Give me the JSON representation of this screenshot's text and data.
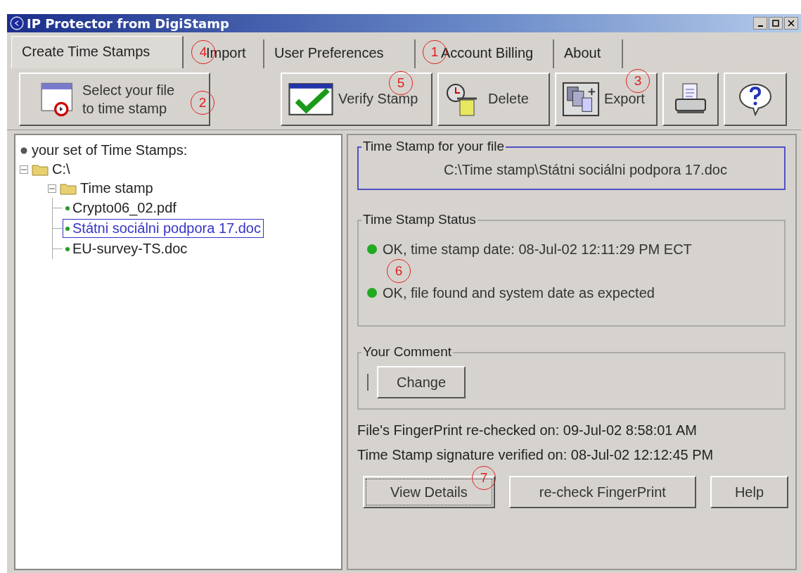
{
  "window": {
    "title": "IP Protector from DigiStamp"
  },
  "tabs": [
    {
      "label": "Create Time Stamps",
      "selected": true
    },
    {
      "label": "Import",
      "selected": false
    },
    {
      "label": "User Preferences",
      "selected": false
    },
    {
      "label": "Account Billing",
      "selected": false
    },
    {
      "label": "About",
      "selected": false
    }
  ],
  "toolbar": [
    {
      "kind": "select",
      "label_lines": [
        "Select your file",
        "to time stamp"
      ]
    },
    {
      "kind": "verify",
      "label": "Verify Stamp"
    },
    {
      "kind": "delete",
      "label": "Delete"
    },
    {
      "kind": "export",
      "label": "Export"
    },
    {
      "kind": "print"
    },
    {
      "kind": "help"
    }
  ],
  "tree": {
    "root": "your set of Time Stamps:",
    "children": [
      {
        "label": "C:\\",
        "kind": "folder",
        "expanded": true,
        "children": [
          {
            "label": "Time stamp",
            "kind": "folder",
            "expanded": true,
            "children": [
              {
                "label": "Crypto06_02.pdf",
                "kind": "file",
                "selected": false
              },
              {
                "label": "Státni sociálni podpora 17.doc",
                "kind": "file",
                "selected": true
              },
              {
                "label": "EU-survey-TS.doc",
                "kind": "file",
                "selected": false
              }
            ]
          }
        ]
      }
    ]
  },
  "file_group": {
    "title": "Time Stamp for your file",
    "path": "C:\\Time stamp\\Státni sociálni podpora 17.doc"
  },
  "status_group": {
    "title": "Time Stamp Status",
    "items": [
      {
        "text": "OK, time stamp date: 08-Jul-02 12:11:29 PM ECT",
        "color": "#22aa22"
      },
      {
        "text": "OK, file found and system date as expected",
        "color": "#22aa22"
      }
    ]
  },
  "comment_group": {
    "title": "Your Comment",
    "button": "Change"
  },
  "info_lines": [
    "File's FingerPrint re-checked on: 09-Jul-02 8:58:01 AM",
    "Time Stamp signature verified on: 08-Jul-02 12:12:45 PM"
  ],
  "bottom_buttons": [
    "View Details",
    "re-check FingerPrint",
    "Help"
  ],
  "annotations": [
    "4",
    "1",
    "5",
    "3",
    "2",
    "6",
    "7"
  ]
}
